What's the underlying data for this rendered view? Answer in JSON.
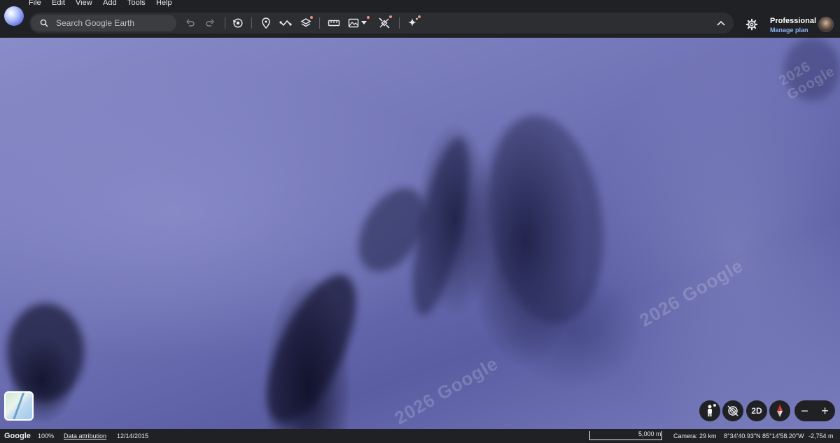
{
  "menu": {
    "items": [
      "File",
      "Edit",
      "View",
      "Add",
      "Tools",
      "Help"
    ]
  },
  "search": {
    "placeholder": "Search Google Earth"
  },
  "toolbar": {
    "icons": [
      "undo-icon",
      "redo-icon",
      "historical-imagery-icon",
      "placemark-icon",
      "path-icon",
      "layers-icon",
      "measure-icon",
      "map-style-icon",
      "satellite-icon",
      "ai-sparkle-icon",
      "collapse-icon"
    ]
  },
  "account": {
    "plan_name": "Professional",
    "manage_label": "Manage plan"
  },
  "map": {
    "watermarks": [
      "2026 Google",
      "2026 Google",
      "2026 Google"
    ]
  },
  "controls": {
    "view_mode_label": "2D",
    "zoom_out": "−",
    "zoom_in": "+"
  },
  "status": {
    "brand": "Google",
    "zoom": "100%",
    "attribution": "Data attribution",
    "date": "12/14/2015",
    "scale": "5,000 m",
    "camera": "Camera: 29 km",
    "coords": "8°34'40.93\"N 85°14'58.20\"W",
    "elevation": "-2,754 m"
  },
  "colors": {
    "bar_bg": "#202124",
    "accent_link": "#8ab4f8",
    "notification_dot": "#f28b82"
  }
}
